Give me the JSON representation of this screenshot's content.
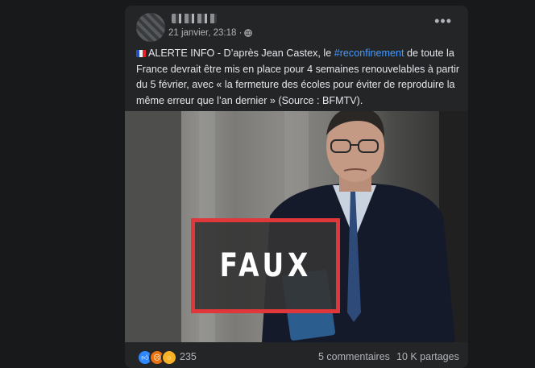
{
  "post": {
    "timestamp": "21 janvier, 23:18 ·",
    "text_before": "ALERTE INFO - D’après Jean Castex, le ",
    "hashtag": "#reconfinement",
    "text_after": " de toute la France devrait être mis en place pour 4 semaines renouvelables à partir du 5 février, avec « la fermeture des écoles pour éviter de reproduire la même erreur que l’an dernier » (Source : BFMTV).",
    "stamp": "FAUX",
    "reaction_count": "235",
    "comments": "5 commentaires",
    "shares": "10 K partages"
  },
  "icons": {
    "flag": "france-flag-icon",
    "privacy": "globe-icon",
    "menu": "more-options-icon",
    "reactions": [
      "like-icon",
      "angry-icon",
      "wow-icon"
    ]
  },
  "colors": {
    "background": "#18191a",
    "card": "#242526",
    "text": "#e4e6eb",
    "secondary": "#b0b3b8",
    "hashtag": "#4599ff",
    "stamp_border": "#e0373b"
  }
}
